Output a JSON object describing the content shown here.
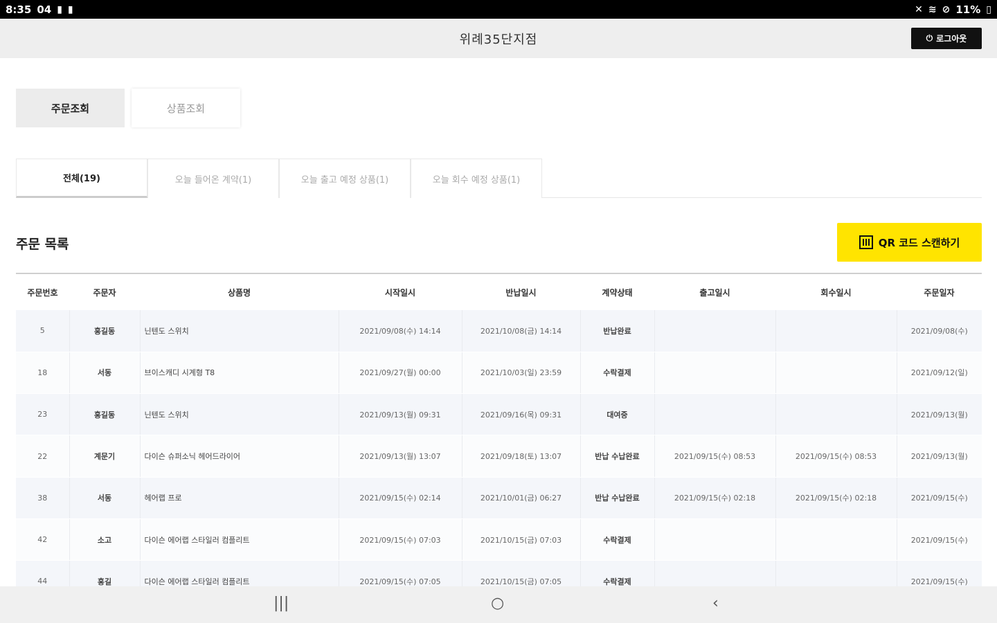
{
  "status_bar": {
    "time": "8:35",
    "left_indicators": "04",
    "battery": "11%",
    "icons": [
      "mute-icon",
      "wifi-icon",
      "alarm-icon",
      "battery-icon"
    ]
  },
  "app_bar": {
    "store_name": "위례35단지점",
    "logout_label": "로그아웃"
  },
  "main_tabs": [
    {
      "label": "주문조회",
      "active": true
    },
    {
      "label": "상품조회",
      "active": false
    }
  ],
  "filter_tabs": [
    {
      "label": "전체(19)",
      "active": true
    },
    {
      "label": "오늘 들어온 계약(1)",
      "active": false
    },
    {
      "label": "오늘 출고 예정 상품(1)",
      "active": false
    },
    {
      "label": "오늘 회수 예정 상품(1)",
      "active": false
    }
  ],
  "orders": {
    "title": "주문 목록",
    "qr_button_label": "QR 코드 스캔하기",
    "columns": [
      "주문번호",
      "주문자",
      "상품명",
      "시작일시",
      "반납일시",
      "계약상태",
      "출고일시",
      "회수일시",
      "주문일자"
    ],
    "rows": [
      [
        "5",
        "홍길동",
        "닌텐도 스위치",
        "2021/09/08(수) 14:14",
        "2021/10/08(금) 14:14",
        "반납완료",
        "",
        "",
        "2021/09/08(수)"
      ],
      [
        "18",
        "서동",
        "브이스캐디 시계형 T8",
        "2021/09/27(월) 00:00",
        "2021/10/03(일) 23:59",
        "수락결제",
        "",
        "",
        "2021/09/12(일)"
      ],
      [
        "23",
        "홍길동",
        "닌텐도 스위치",
        "2021/09/13(월) 09:31",
        "2021/09/16(목) 09:31",
        "대여중",
        "",
        "",
        "2021/09/13(월)"
      ],
      [
        "22",
        "계문기",
        "다이슨 슈퍼소닉 헤어드라이어",
        "2021/09/13(월) 13:07",
        "2021/09/18(토) 13:07",
        "반납 수납완료",
        "2021/09/15(수) 08:53",
        "2021/09/15(수) 08:53",
        "2021/09/13(월)"
      ],
      [
        "38",
        "서동",
        "헤어랩 프로",
        "2021/09/15(수) 02:14",
        "2021/10/01(금) 06:27",
        "반납 수납완료",
        "2021/09/15(수) 02:18",
        "2021/09/15(수) 02:18",
        "2021/09/15(수)"
      ],
      [
        "42",
        "소고",
        "다이슨 에어랩 스타일러 컴플리트",
        "2021/09/15(수) 07:03",
        "2021/10/15(금) 07:03",
        "수락결제",
        "",
        "",
        "2021/09/15(수)"
      ],
      [
        "44",
        "홍길",
        "다이슨 에어랩 스타일러 컴플리트",
        "2021/09/15(수) 07:05",
        "2021/10/15(금) 07:05",
        "수락결제",
        "",
        "",
        "2021/09/15(수)"
      ]
    ]
  },
  "nav_bar": {
    "recent_glyph": "|||",
    "home_glyph": "○",
    "back_glyph": "‹"
  }
}
